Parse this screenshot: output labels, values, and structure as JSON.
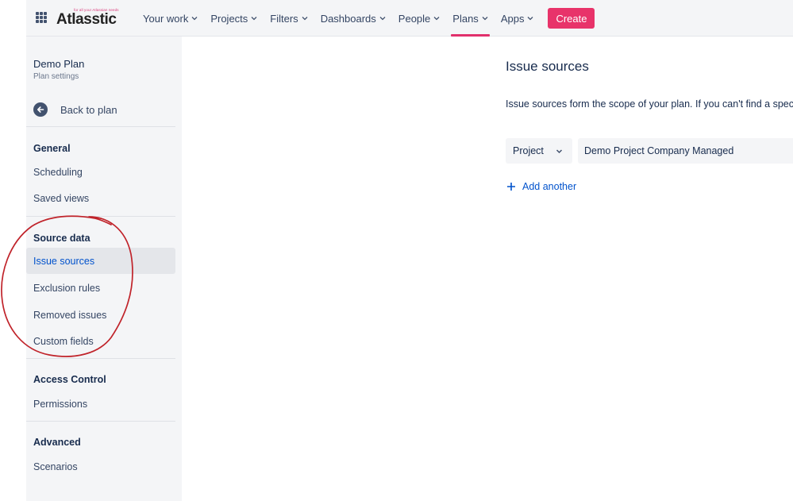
{
  "brand": {
    "tagline": "for all your Atlassian needs",
    "name": "Atlasstic",
    "accent": "#e8336a",
    "link_color": "#0052cc"
  },
  "nav": {
    "items": [
      {
        "label": "Your work"
      },
      {
        "label": "Projects"
      },
      {
        "label": "Filters"
      },
      {
        "label": "Dashboards"
      },
      {
        "label": "People"
      },
      {
        "label": "Plans",
        "active": true
      },
      {
        "label": "Apps"
      }
    ],
    "create_label": "Create"
  },
  "sidebar": {
    "plan_title": "Demo Plan",
    "plan_subtitle": "Plan settings",
    "back_label": "Back to plan",
    "sections": [
      {
        "heading": "General",
        "items": [
          "Scheduling",
          "Saved views"
        ]
      },
      {
        "heading": "Source data",
        "items": [
          "Issue sources",
          "Exclusion rules",
          "Removed issues",
          "Custom fields"
        ],
        "selected": "Issue sources"
      },
      {
        "heading": "Access Control",
        "items": [
          "Permissions"
        ]
      },
      {
        "heading": "Advanced",
        "items": [
          "Scenarios"
        ]
      }
    ]
  },
  "main": {
    "title": "Issue sources",
    "description": "Issue sources form the scope of your plan. If you can't find a specific is",
    "source_type": "Project",
    "source_value": "Demo Project Company Managed",
    "add_another_label": "Add another"
  }
}
